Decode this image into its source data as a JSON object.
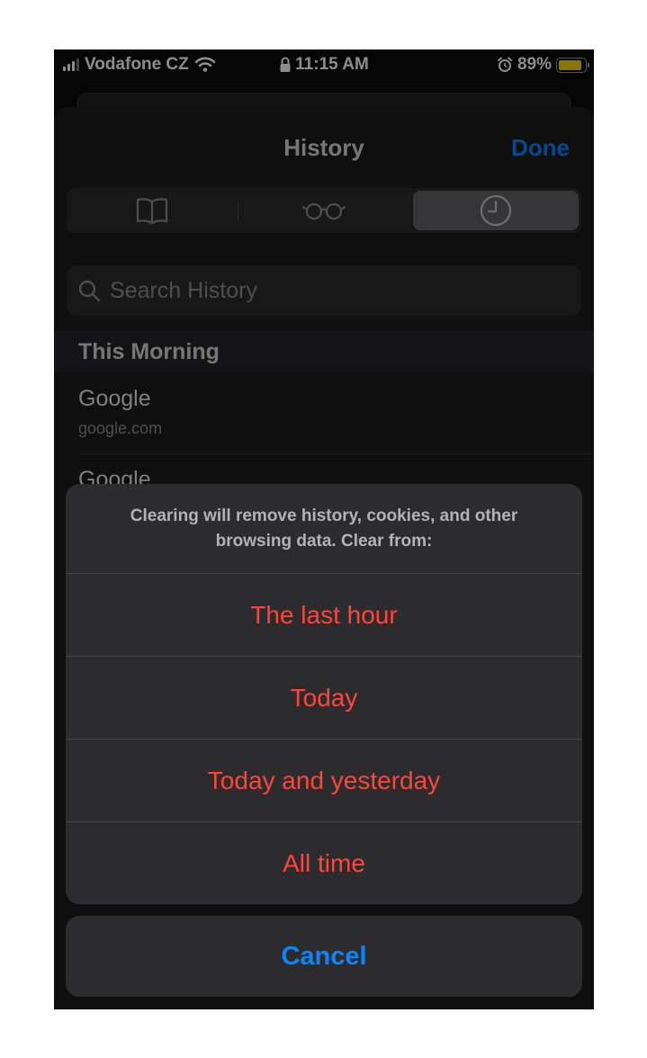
{
  "status_bar": {
    "carrier": "Vodafone CZ",
    "time": "11:15 AM",
    "battery": "89%",
    "battery_color": "#ffd60a"
  },
  "header": {
    "title": "History",
    "done_label": "Done"
  },
  "tabs": [
    {
      "icon": "book-icon",
      "selected": false
    },
    {
      "icon": "reading-list-glasses-icon",
      "selected": false
    },
    {
      "icon": "clock-history-icon",
      "selected": true
    }
  ],
  "search": {
    "placeholder": "Search History"
  },
  "history": {
    "section_title": "This Morning",
    "items": [
      {
        "title": "Google",
        "url": "google.com"
      },
      {
        "title": "Google",
        "url": ""
      }
    ]
  },
  "action_sheet": {
    "message": "Clearing will remove history, cookies, and other browsing data. Clear from:",
    "options": [
      "The last hour",
      "Today",
      "Today and yesterday",
      "All time"
    ],
    "cancel_label": "Cancel",
    "destructive_color": "#ff453a",
    "accent_color": "#0a84ff"
  }
}
